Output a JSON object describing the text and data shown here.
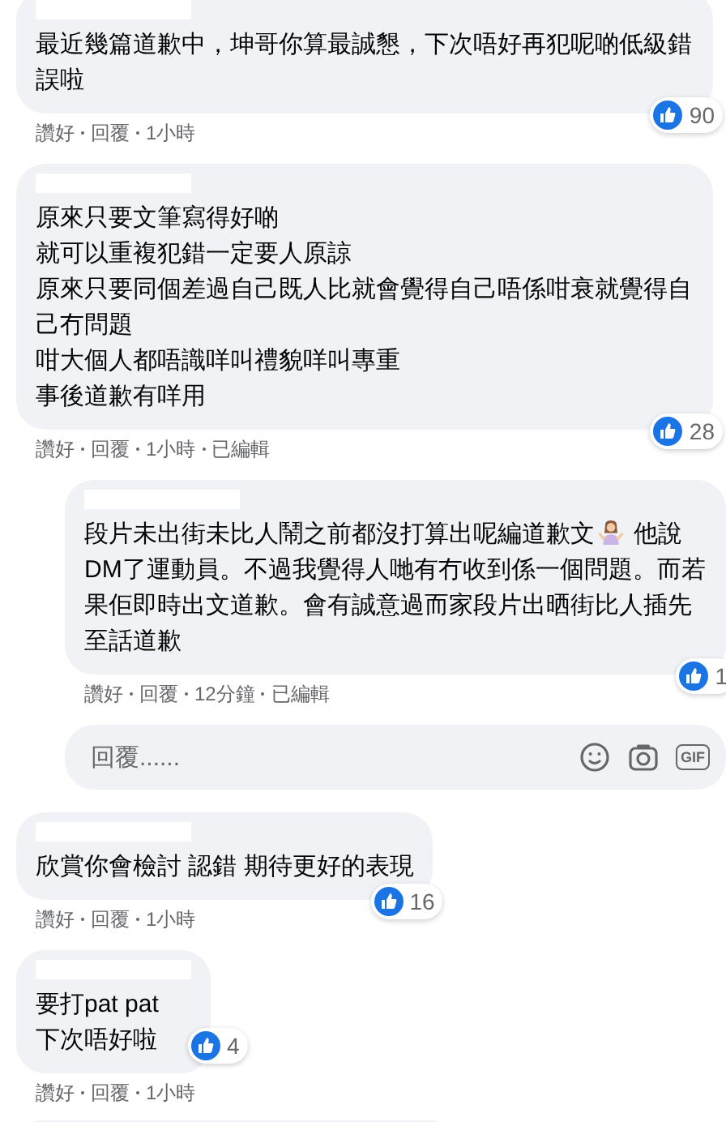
{
  "comments": [
    {
      "kind": "comment",
      "lines": [
        [
          {
            "kind": "text",
            "text": "最近幾篇道歉中，坤哥你算最誠懇，下次唔好再犯呢啲低級錯誤啦"
          }
        ]
      ],
      "reactions": "90",
      "actions": [
        "讚好",
        "回覆"
      ],
      "time": "1小時"
    },
    {
      "kind": "comment",
      "lines": [
        [
          {
            "kind": "text",
            "text": "原來只要文筆寫得好啲"
          }
        ],
        [
          {
            "kind": "text",
            "text": "就可以重複犯錯一定要人原諒"
          }
        ],
        [
          {
            "kind": "text",
            "text": "原來只要同個差過自己既人比就會覺得自己唔係咁衰就覺得自己冇問題"
          }
        ],
        [
          {
            "kind": "text",
            "text": "咁大個人都唔識咩叫禮貌咩叫專重"
          }
        ],
        [
          {
            "kind": "text",
            "text": "事後道歉有咩用"
          }
        ]
      ],
      "reactions": "28",
      "actions": [
        "讚好",
        "回覆"
      ],
      "time": "1小時",
      "edited": "已編輯"
    },
    {
      "kind": "reply",
      "lines": [
        [
          {
            "kind": "text",
            "text": "段片未出街未比人鬧之前都沒打算出呢編道歉文"
          },
          {
            "kind": "emoji"
          },
          {
            "kind": "text",
            "text": " 他說DM了運動員。不過我覺得人哋有冇收到係一個問題。而若果佢即時出文道歉。會有誠意過而家段片出晒街比人插先至話道歉"
          }
        ]
      ],
      "reactions": "1",
      "actions": [
        "讚好",
        "回覆"
      ],
      "time": "12分鐘",
      "edited": "已編輯"
    },
    {
      "kind": "reply_box",
      "placeholder": "回覆......",
      "gif_label": "GIF"
    },
    {
      "kind": "comment",
      "lines": [
        [
          {
            "kind": "text",
            "text": "欣賞你會檢討 認錯 期待更好的表現"
          }
        ]
      ],
      "reactions": "16",
      "actions": [
        "讚好",
        "回覆"
      ],
      "time": "1小時"
    },
    {
      "kind": "comment",
      "lines": [
        [
          {
            "kind": "text",
            "text": "要打pat pat"
          }
        ],
        [
          {
            "kind": "text",
            "text": "下次唔好啦"
          }
        ]
      ],
      "reactions": "4",
      "actions": [
        "讚好",
        "回覆"
      ],
      "time": "1小時"
    },
    {
      "kind": "stub"
    }
  ]
}
